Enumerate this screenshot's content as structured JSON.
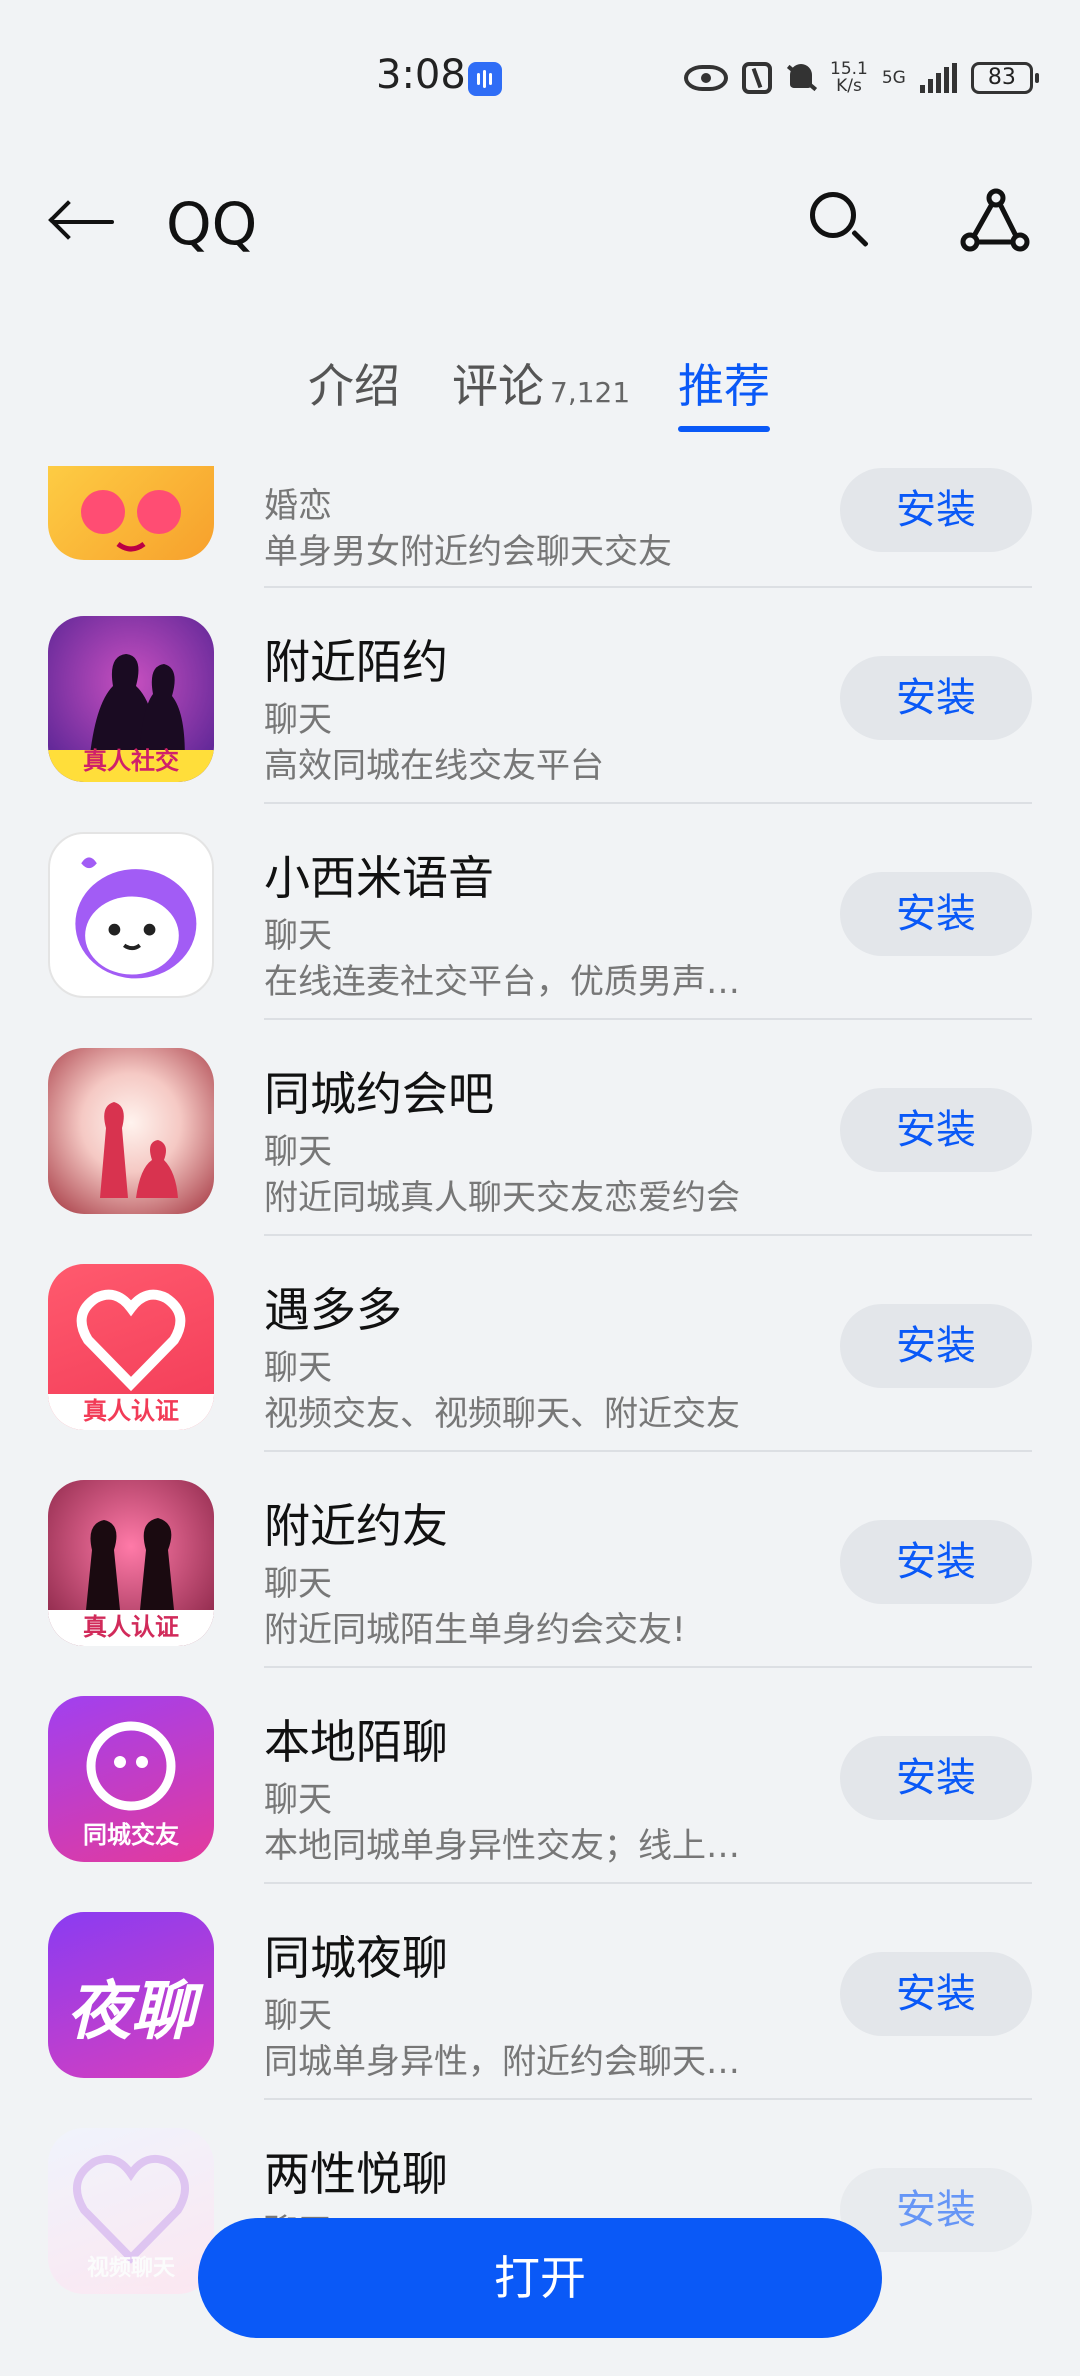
{
  "status": {
    "time": "3:08",
    "net_speed": "15.1",
    "net_unit": "K/s",
    "net_type": "5G",
    "battery": "83"
  },
  "header": {
    "title": "QQ"
  },
  "tabs": [
    {
      "label": "介绍"
    },
    {
      "label": "评论",
      "count": "7,121"
    },
    {
      "label": "推荐"
    }
  ],
  "apps": [
    {
      "name": "",
      "category": "婚恋",
      "desc": "单身男女附近约会聊天交友",
      "install": "安装",
      "icon": "heart-eyes-cat-icon"
    },
    {
      "name": "附近陌约",
      "category": "聊天",
      "desc": "高效同城在线交友平台",
      "install": "安装",
      "icon": "couple-silhouette-icon",
      "badge": "真人社交"
    },
    {
      "name": "小西米语音",
      "category": "聊天",
      "desc": "在线连麦社交平台，优质男声…",
      "install": "安装",
      "icon": "cute-face-icon"
    },
    {
      "name": "同城约会吧",
      "category": "聊天",
      "desc": "附近同城真人聊天交友恋爱约会",
      "install": "安装",
      "icon": "proposal-silhouette-icon"
    },
    {
      "name": "遇多多",
      "category": "聊天",
      "desc": "视频交友、视频聊天、附近交友",
      "install": "安装",
      "icon": "chat-heart-icon",
      "badge": "真人认证"
    },
    {
      "name": "附近约友",
      "category": "聊天",
      "desc": "附近同城陌生单身约会交友!",
      "install": "安装",
      "icon": "couple-hands-icon",
      "badge": "真人认证"
    },
    {
      "name": "本地陌聊",
      "category": "聊天",
      "desc": "本地同城单身异性交友；线上…",
      "install": "安装",
      "icon": "chat-bubble-face-icon",
      "badge": "同城交友"
    },
    {
      "name": "同城夜聊",
      "category": "聊天",
      "desc": "同城单身异性，附近约会聊天…",
      "install": "安装",
      "icon": "night-chat-icon",
      "badge": "夜聊"
    },
    {
      "name": "两性悦聊",
      "category": "聊天",
      "desc": "",
      "install": "安装",
      "icon": "heart-couple-icon",
      "badge": "视频聊天"
    }
  ],
  "open_button": "打开"
}
